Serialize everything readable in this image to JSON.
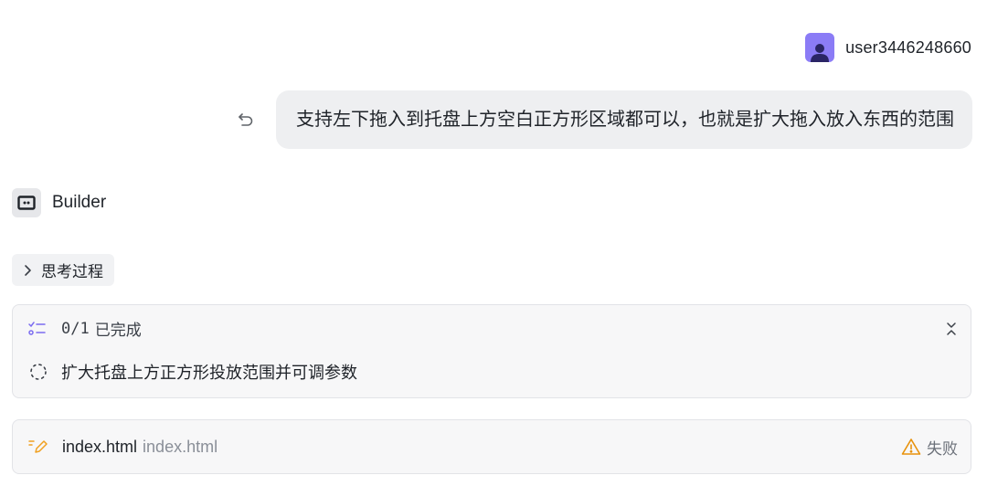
{
  "user": {
    "name": "user3446248660"
  },
  "message": {
    "text": "支持左下拖入到托盘上方空白正方形区域都可以，也就是扩大拖入放入东西的范围"
  },
  "agent": {
    "name": "Builder"
  },
  "thinking": {
    "label": "思考过程"
  },
  "tasks": {
    "count": "0/1",
    "status_label": "已完成",
    "items": [
      {
        "label": "扩大托盘上方正方形投放范围并可调参数"
      }
    ]
  },
  "file": {
    "name": "index.html",
    "path": "index.html",
    "status": "失败"
  },
  "colors": {
    "avatar": "#8b7cf6",
    "accent_purple": "#7b6cf0",
    "edit_orange": "#f0a020",
    "warning_orange": "#e8920c",
    "bubble_bg": "#eeeff1"
  }
}
